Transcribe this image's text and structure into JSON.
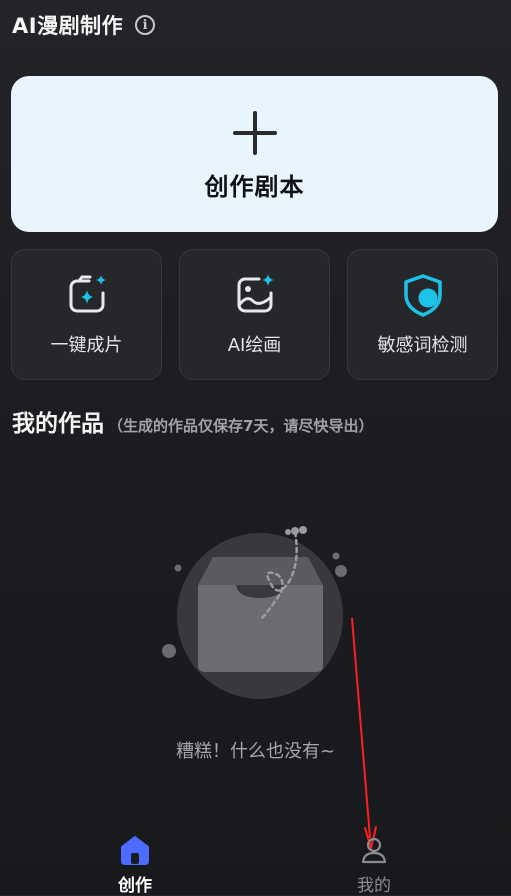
{
  "header": {
    "title": "AI漫剧制作",
    "info_icon": "info-icon"
  },
  "create_card": {
    "label": "创作剧本",
    "icon": "plus-icon"
  },
  "tools": [
    {
      "label": "一键成片",
      "icon": "image-sparkle-icon"
    },
    {
      "label": "AI绘画",
      "icon": "paint-sparkle-icon"
    },
    {
      "label": "敏感词检测",
      "icon": "shield-check-icon"
    }
  ],
  "works": {
    "title": "我的作品",
    "note": "（生成的作品仅保存7天，请尽快导出）",
    "empty_text": "糟糕！什么也没有~",
    "empty_icon": "empty-inbox-icon"
  },
  "bottom_nav": {
    "items": [
      {
        "label": "创作",
        "icon": "home-icon",
        "active": true
      },
      {
        "label": "我的",
        "icon": "user-icon",
        "active": false
      }
    ]
  },
  "colors": {
    "background": "#1f2023",
    "card_light": "#e8f5fd",
    "card_dark": "#26272b",
    "accent_cyan": "#1cc3e8",
    "nav_active_blue": "#4d6bfe",
    "annotation_red": "#ff1e1e"
  }
}
